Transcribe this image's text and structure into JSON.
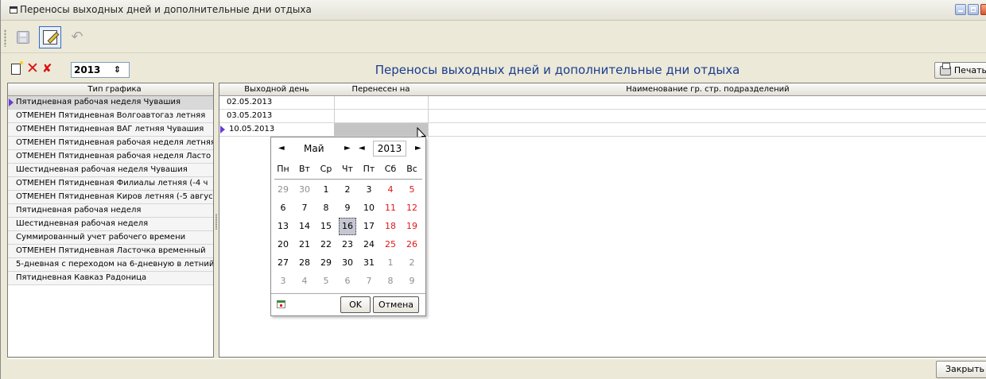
{
  "window": {
    "title": "Переносы выходных дней и дополнительные дни отдыха"
  },
  "toolbar": {
    "save_icon": "save-icon",
    "edit_icon": "edit-icon",
    "undo_icon": "undo-icon"
  },
  "filter": {
    "year": "2013",
    "spinner": "⇕"
  },
  "main": {
    "title": "Переносы выходных дней и дополнительные дни отдыха",
    "print_label": "Печать"
  },
  "schedule_types": {
    "header": "Тип графика",
    "items": [
      "Пятидневная рабочая неделя Чувашия",
      "ОТМЕНЕН Пятидневная Волгоавтогаз летняя",
      "ОТМЕНЕН Пятидневная ВАГ летняя Чувашия",
      "ОТМЕНЕН Пятидневная рабочая неделя летняя",
      "ОТМЕНЕН Пятидневная рабочая неделя Ласто",
      "Шестидневная рабочая неделя Чувашия",
      "ОТМЕНЕН Пятидневная Филиалы летняя (-4 ч",
      "ОТМЕНЕН Пятидневная Киров летняя (-5 авгус",
      "Пятидневная рабочая неделя",
      "Шестидневная рабочая неделя",
      "Суммированный учет рабочего времени",
      "ОТМЕНЕН Пятидневная Ласточка временный",
      "5-дневная с переходом на 6-дневную в летний п",
      "Пятидневная Кавказ Радоница"
    ]
  },
  "transfers": {
    "headers": {
      "day_off": "Выходной день",
      "moved_to": "Перенесен на",
      "departments": "Наименование гр. стр. подразделений"
    },
    "rows": [
      {
        "day_off": "02.05.2013",
        "moved_to": "",
        "departments": ""
      },
      {
        "day_off": "03.05.2013",
        "moved_to": "",
        "departments": ""
      },
      {
        "day_off": "10.05.2013",
        "moved_to": "",
        "departments": ""
      }
    ]
  },
  "calendar": {
    "month": "Май",
    "year": "2013",
    "prev": "◄",
    "next": "►",
    "weekdays": [
      "Пн",
      "Вт",
      "Ср",
      "Чт",
      "Пт",
      "Сб",
      "Вс"
    ],
    "weeks": [
      [
        "29",
        "30",
        "1",
        "2",
        "3",
        "4",
        "5"
      ],
      [
        "6",
        "7",
        "8",
        "9",
        "10",
        "11",
        "12"
      ],
      [
        "13",
        "14",
        "15",
        "16",
        "17",
        "18",
        "19"
      ],
      [
        "20",
        "21",
        "22",
        "23",
        "24",
        "25",
        "26"
      ],
      [
        "27",
        "28",
        "29",
        "30",
        "31",
        "1",
        "2"
      ],
      [
        "3",
        "4",
        "5",
        "6",
        "7",
        "8",
        "9"
      ]
    ],
    "selected_day": "16",
    "ok_label": "OK",
    "cancel_label": "Отмена"
  },
  "footer": {
    "close_label": "Закрыть"
  }
}
